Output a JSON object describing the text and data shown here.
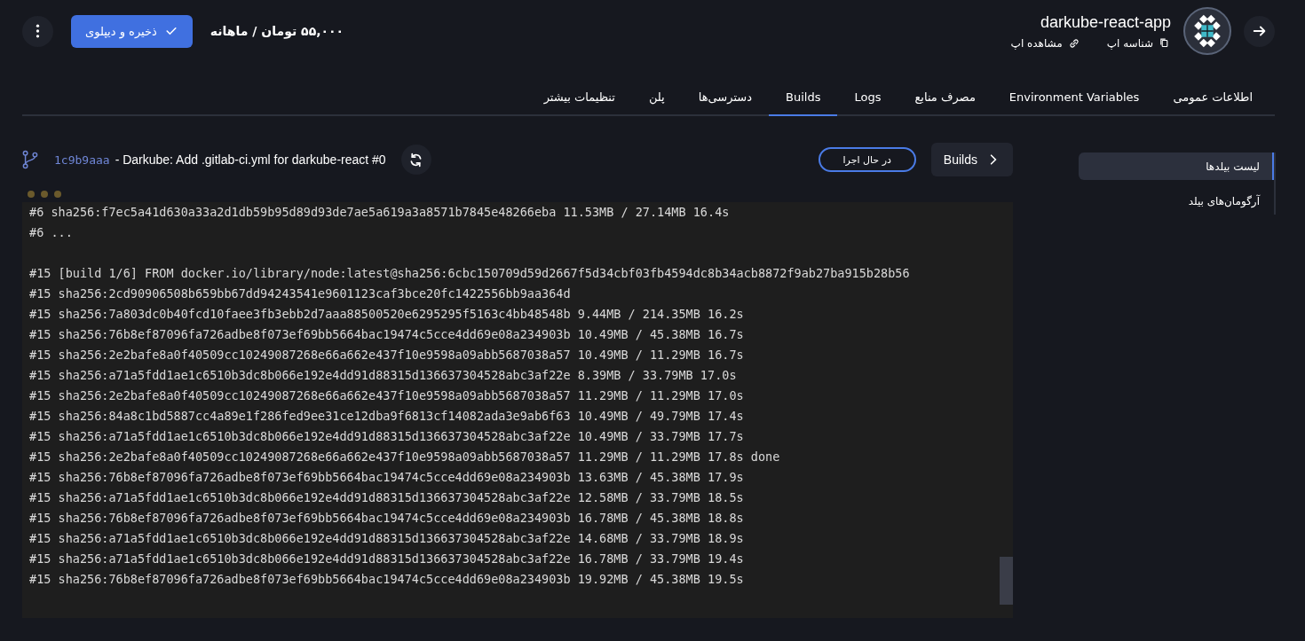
{
  "header": {
    "app_name": "darkube-react-app",
    "links": [
      {
        "kind": "copy",
        "label": "شناسه اپ"
      },
      {
        "kind": "link",
        "label": "مشاهده اپ"
      }
    ],
    "price": "۵۵,۰۰۰ تومان / ماهانه",
    "save_button": "ذخیره و دیپلوی"
  },
  "tabs": [
    {
      "label": "اطلاعات عمومی",
      "selected": false
    },
    {
      "label": "Environment Variables",
      "selected": false
    },
    {
      "label": "مصرف منابع",
      "selected": false
    },
    {
      "label": "Logs",
      "selected": false
    },
    {
      "label": "Builds",
      "selected": true
    },
    {
      "label": "دسترسی‌ها",
      "selected": false
    },
    {
      "label": "پلن",
      "selected": false
    },
    {
      "label": "تنظیمات بیشتر",
      "selected": false
    }
  ],
  "sidebar": {
    "items": [
      {
        "label": "لیست بیلدها",
        "selected": true
      },
      {
        "label": "آرگومان‌های بیلد",
        "selected": false
      }
    ]
  },
  "build": {
    "back_button": "Builds",
    "status": "در حال اجرا",
    "commit": "1c9b9aaa",
    "message": "- Darkube: Add .gitlab-ci.yml for darkube-react #0"
  },
  "log": {
    "blocks": [
      [
        "#6 sha256:f7ec5a41d630a33a2d1db59b95d89d93de7ae5a619a3a8571b7845e48266eba 11.53MB / 27.14MB 16.4s",
        "#6 ..."
      ],
      [
        "#15 [build 1/6] FROM docker.io/library/node:latest@sha256:6cbc150709d59d2667f5d34cbf03fb4594dc8b34acb8872f9ab27ba915b28b56",
        "#15 sha256:2cd90906508b659bb67dd94243541e9601123caf3bce20fc1422556bb9aa364d",
        "#15 sha256:7a803dc0b40fcd10faee3fb3ebb2d7aaa88500520e6295295f5163c4bb48548b 9.44MB / 214.35MB 16.2s",
        "#15 sha256:76b8ef87096fa726adbe8f073ef69bb5664bac19474c5cce4dd69e08a234903b 10.49MB / 45.38MB 16.7s",
        "#15 sha256:2e2bafe8a0f40509cc10249087268e66a662e437f10e9598a09abb5687038a57 10.49MB / 11.29MB 16.7s",
        "#15 sha256:a71a5fdd1ae1c6510b3dc8b066e192e4dd91d88315d136637304528abc3af22e 8.39MB / 33.79MB 17.0s",
        "#15 sha256:2e2bafe8a0f40509cc10249087268e66a662e437f10e9598a09abb5687038a57 11.29MB / 11.29MB 17.0s",
        "#15 sha256:84a8c1bd5887cc4a89e1f286fed9ee31ce12dba9f6813cf14082ada3e9ab6f63 10.49MB / 49.79MB 17.4s",
        "#15 sha256:a71a5fdd1ae1c6510b3dc8b066e192e4dd91d88315d136637304528abc3af22e 10.49MB / 33.79MB 17.7s",
        "#15 sha256:2e2bafe8a0f40509cc10249087268e66a662e437f10e9598a09abb5687038a57 11.29MB / 11.29MB 17.8s done",
        "#15 sha256:76b8ef87096fa726adbe8f073ef69bb5664bac19474c5cce4dd69e08a234903b 13.63MB / 45.38MB 17.9s",
        "#15 sha256:a71a5fdd1ae1c6510b3dc8b066e192e4dd91d88315d136637304528abc3af22e 12.58MB / 33.79MB 18.5s",
        "#15 sha256:76b8ef87096fa726adbe8f073ef69bb5664bac19474c5cce4dd69e08a234903b 16.78MB / 45.38MB 18.8s",
        "#15 sha256:a71a5fdd1ae1c6510b3dc8b066e192e4dd91d88315d136637304528abc3af22e 14.68MB / 33.79MB 18.9s",
        "#15 sha256:a71a5fdd1ae1c6510b3dc8b066e192e4dd91d88315d136637304528abc3af22e 16.78MB / 33.79MB 19.4s",
        "#15 sha256:76b8ef87096fa726adbe8f073ef69bb5664bac19474c5cce4dd69e08a234903b 19.92MB / 45.38MB 19.5s"
      ]
    ]
  }
}
